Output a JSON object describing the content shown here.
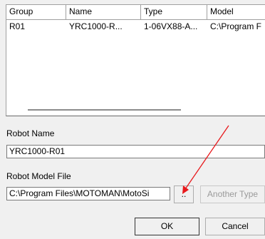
{
  "list": {
    "columns": [
      "Group",
      "Name",
      "Type",
      "Model"
    ],
    "rows": [
      {
        "group": "R01",
        "name": "YRC1000-R...",
        "type": "1-06VX88-A...",
        "model": "C:\\Program F"
      }
    ]
  },
  "robot_name": {
    "label": "Robot Name",
    "value": "YRC1000-R01"
  },
  "robot_model_file": {
    "label": "Robot Model File",
    "value": "C:\\Program Files\\MOTOMAN\\MotoSi"
  },
  "buttons": {
    "browse": "..",
    "another_type": "Another Type",
    "ok": "OK",
    "cancel": "Cancel"
  },
  "colors": {
    "annotation_arrow": "#e8191c"
  }
}
